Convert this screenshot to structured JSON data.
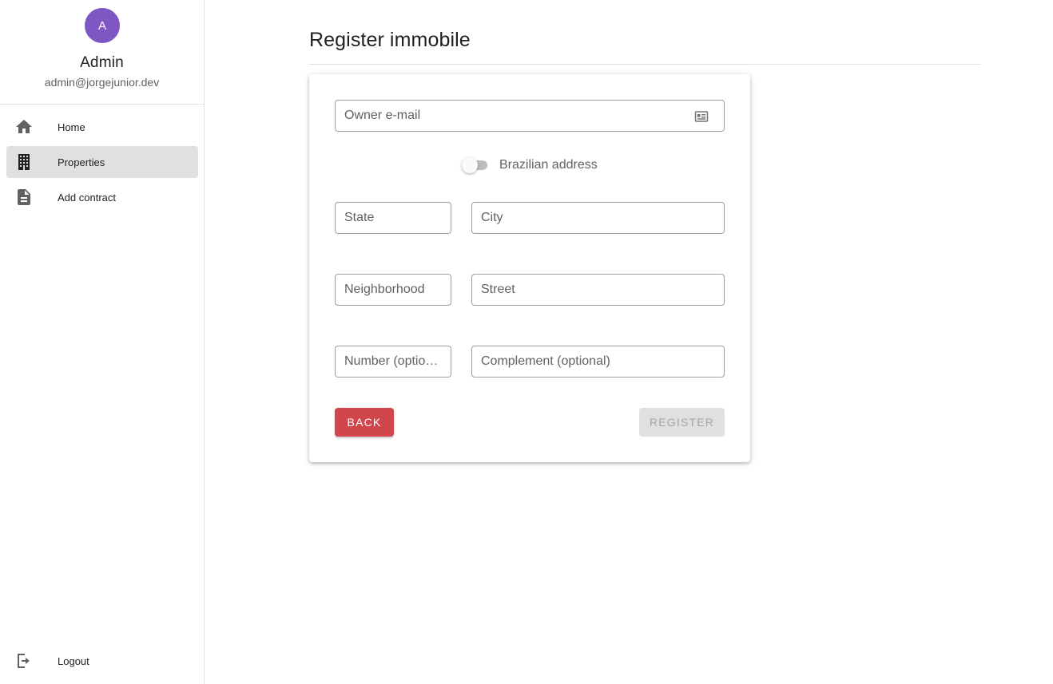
{
  "colors": {
    "avatar_bg": "#7e57c2",
    "back_button_bg": "#d1454d",
    "active_nav_bg": "#e0e0e0",
    "icon_gray": "#616161"
  },
  "profile": {
    "avatar_initial": "A",
    "name": "Admin",
    "email": "admin@jorgejunior.dev"
  },
  "sidebar": {
    "items": [
      {
        "label": "Home",
        "icon": "home-icon",
        "active": false
      },
      {
        "label": "Properties",
        "icon": "building-icon",
        "active": true
      },
      {
        "label": "Add contract",
        "icon": "document-icon",
        "active": false
      }
    ],
    "logout": {
      "label": "Logout",
      "icon": "logout-icon"
    }
  },
  "main": {
    "title": "Register immobile"
  },
  "form": {
    "owner_email": {
      "placeholder": "Owner e-mail",
      "value": "",
      "icon": "contact-card-icon"
    },
    "brazilian_toggle": {
      "label": "Brazilian address",
      "checked": false
    },
    "state": {
      "placeholder": "State",
      "value": ""
    },
    "city": {
      "placeholder": "City",
      "value": ""
    },
    "neighborhood": {
      "placeholder": "Neighborhood",
      "value": ""
    },
    "street": {
      "placeholder": "Street",
      "value": ""
    },
    "number": {
      "placeholder": "Number (optional)",
      "value": ""
    },
    "complement": {
      "placeholder": "Complement (optional)",
      "value": ""
    },
    "back_label": "BACK",
    "register_label": "REGISTER"
  }
}
